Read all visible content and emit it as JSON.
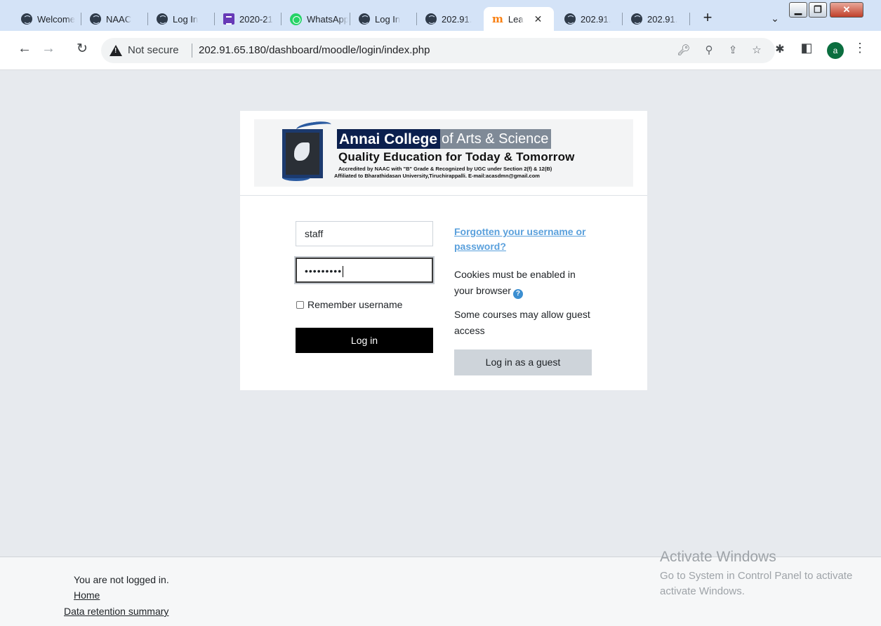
{
  "browser": {
    "tabs": [
      {
        "label": "Welcome",
        "icon": "globe-icon",
        "active": false
      },
      {
        "label": "NAAC",
        "icon": "globe-icon",
        "active": false
      },
      {
        "label": "Log In",
        "icon": "globe-icon",
        "active": false
      },
      {
        "label": "2020-21",
        "icon": "forms-icon",
        "active": false
      },
      {
        "label": "WhatsApp",
        "icon": "whatsapp-icon",
        "active": false
      },
      {
        "label": "Log In",
        "icon": "globe-icon",
        "active": false
      },
      {
        "label": "202.91.",
        "icon": "globe-icon",
        "active": false
      },
      {
        "label": "Lea",
        "icon": "moodle-icon",
        "active": true
      },
      {
        "label": "202.91.",
        "icon": "globe-icon",
        "active": false
      },
      {
        "label": "202.91.",
        "icon": "globe-icon",
        "active": false
      }
    ],
    "new_tab": "+",
    "tab_close": "✕",
    "window_buttons": {
      "minimize": "▁",
      "restore": "❐",
      "close": "✕"
    },
    "not_secure": "Not secure",
    "url": "202.91.65.180/dashboard/moodle/login/index.php",
    "profile_initial": "a"
  },
  "login": {
    "college_name_a": "Annai College",
    "college_name_b": "of Arts & Science",
    "tagline": "Quality Education for Today & Tomorrow",
    "accreditation": "Accredited by NAAC with \"B\" Grade & Recognized by UGC under Section 2(f) & 12(B)",
    "affiliation": "Affiliated to Bharathidasan University,Tiruchirappalli. E-mail:acasdmn@gmail.com",
    "username_value": "staff",
    "password_value": "•••••••••",
    "remember_label": "Remember username",
    "login_button": "Log in",
    "forgot_link": "Forgotten your username or password?",
    "cookies_note": "Cookies must be enabled in your browser",
    "help_glyph": "?",
    "guest_note": "Some courses may allow guest access",
    "guest_button": "Log in as a guest"
  },
  "footer": {
    "not_logged_in": "You are not logged in.",
    "home_link": "Home",
    "data_retention_link": "Data retention summary"
  },
  "watermark": {
    "title": "Activate Windows",
    "subtitle_1": "Go to System in Control Panel to activate",
    "subtitle_2": "activate Windows."
  }
}
